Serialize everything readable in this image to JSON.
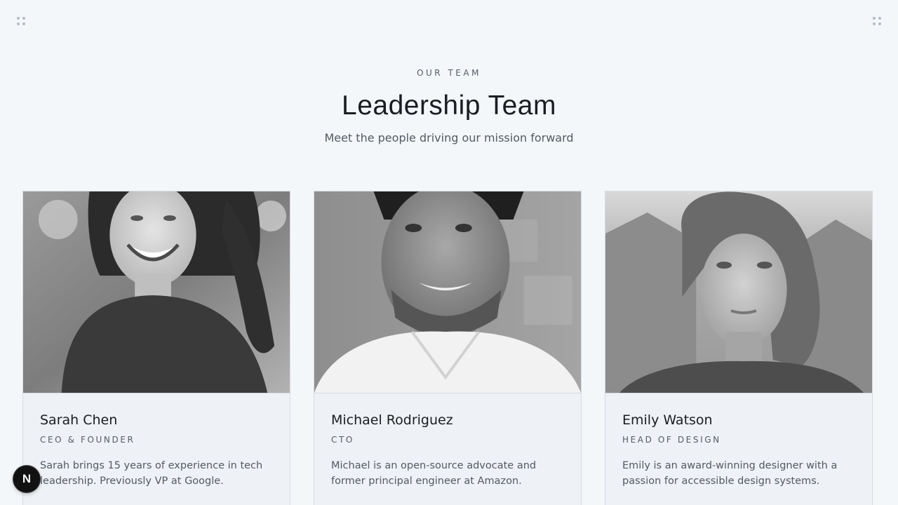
{
  "header": {
    "eyebrow": "OUR TEAM",
    "title": "Leadership Team",
    "subtitle": "Meet the people driving our mission forward"
  },
  "team": [
    {
      "name": "Sarah Chen",
      "role": "CEO & FOUNDER",
      "bio": "Sarah brings 15 years of experience in tech leadership. Previously VP at Google."
    },
    {
      "name": "Michael Rodriguez",
      "role": "CTO",
      "bio": "Michael is an open-source advocate and former principal engineer at Amazon."
    },
    {
      "name": "Emily Watson",
      "role": "HEAD OF DESIGN",
      "bio": "Emily is an award-winning designer with a passion for accessible design systems."
    }
  ],
  "icons": {
    "drag": "drag-handle-icon",
    "social_1": "twitter-icon",
    "social_2": "linkedin-icon",
    "dev_badge": "nextjs-icon"
  },
  "dev_badge": {
    "label": "N"
  },
  "colors": {
    "background": "#f4f7fa",
    "card": "#eef1f5",
    "text_primary": "#1a1d22",
    "text_secondary": "#545a63",
    "border": "#d6dbe2"
  }
}
